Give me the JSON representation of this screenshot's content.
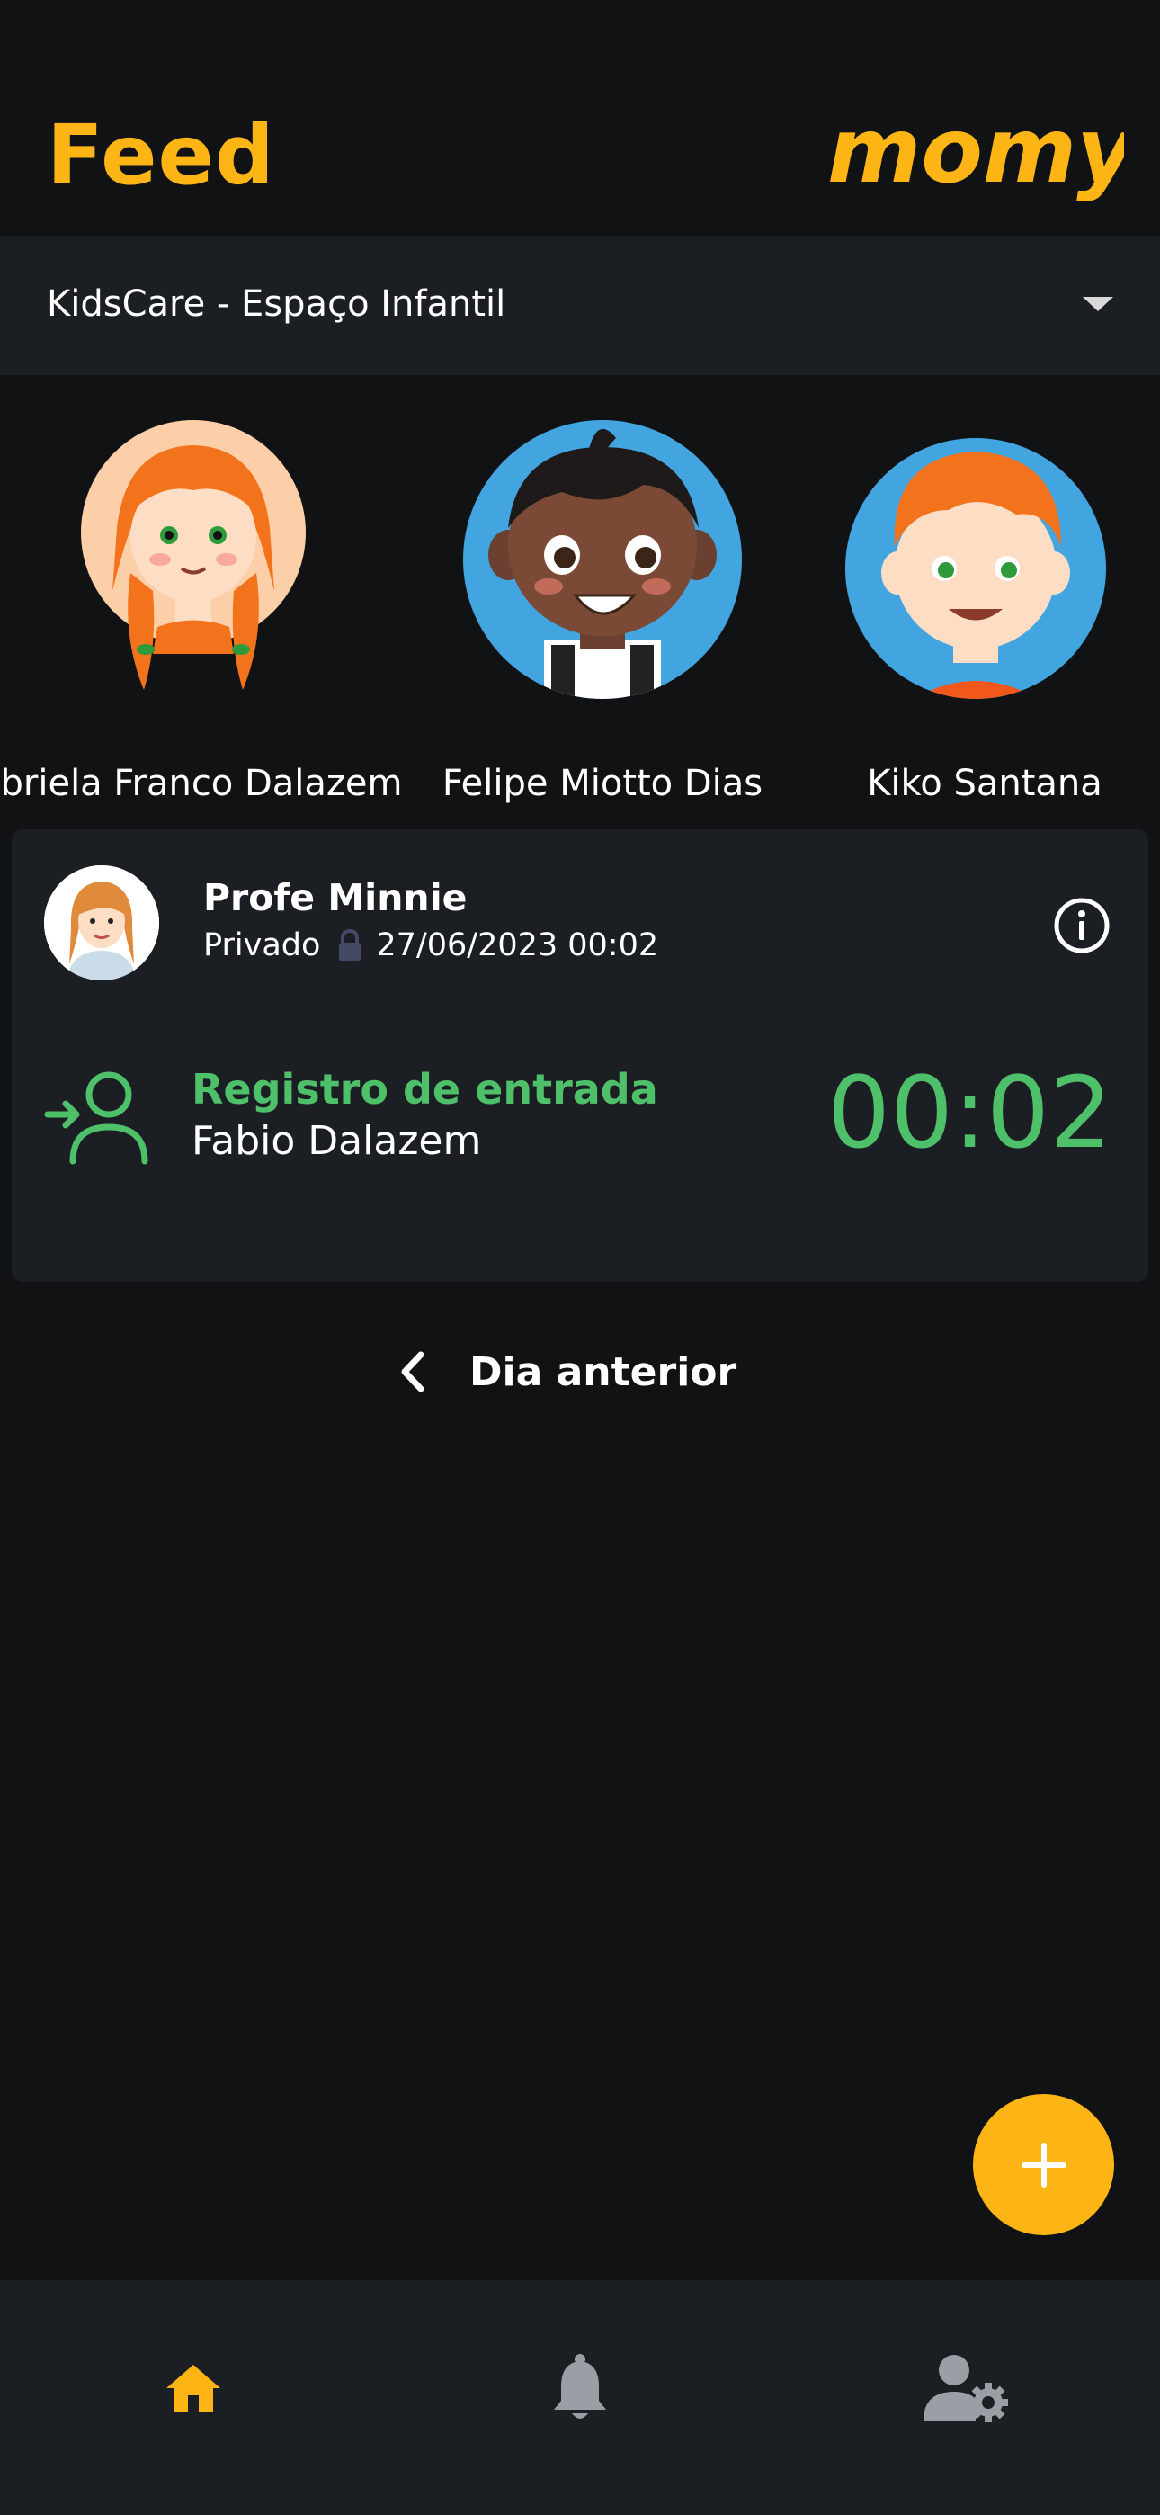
{
  "header": {
    "title": "Feed",
    "logo_text": "momy",
    "logo_color": "#FDB515"
  },
  "school_selector": {
    "selected": "KidsCare - Espaço Infantil"
  },
  "children": [
    {
      "name": "Gabriela Franco Dalazem",
      "avatar": "girl-redhead-avatar"
    },
    {
      "name": "Felipe Miotto Dias",
      "avatar": "boy-dark-avatar"
    },
    {
      "name": "Kiko Santana",
      "avatar": "boy-redhead-avatar"
    }
  ],
  "post": {
    "author": "Profe Minnie",
    "visibility": "Privado",
    "datetime": "27/06/2023 00:02",
    "type": "Registro de entrada",
    "person": "Fabio Dalazem",
    "time": "00:02",
    "accent": "#4FC06A"
  },
  "navigation": {
    "previous_day": "Dia anterior"
  },
  "bottom_nav": {
    "items": [
      {
        "icon": "home-icon",
        "active": true
      },
      {
        "icon": "bell-icon",
        "active": false
      },
      {
        "icon": "user-settings-icon",
        "active": false
      }
    ]
  },
  "colors": {
    "brand": "#FDB515",
    "background": "#111214",
    "surface": "#1B1E22",
    "success": "#4FC06A"
  }
}
